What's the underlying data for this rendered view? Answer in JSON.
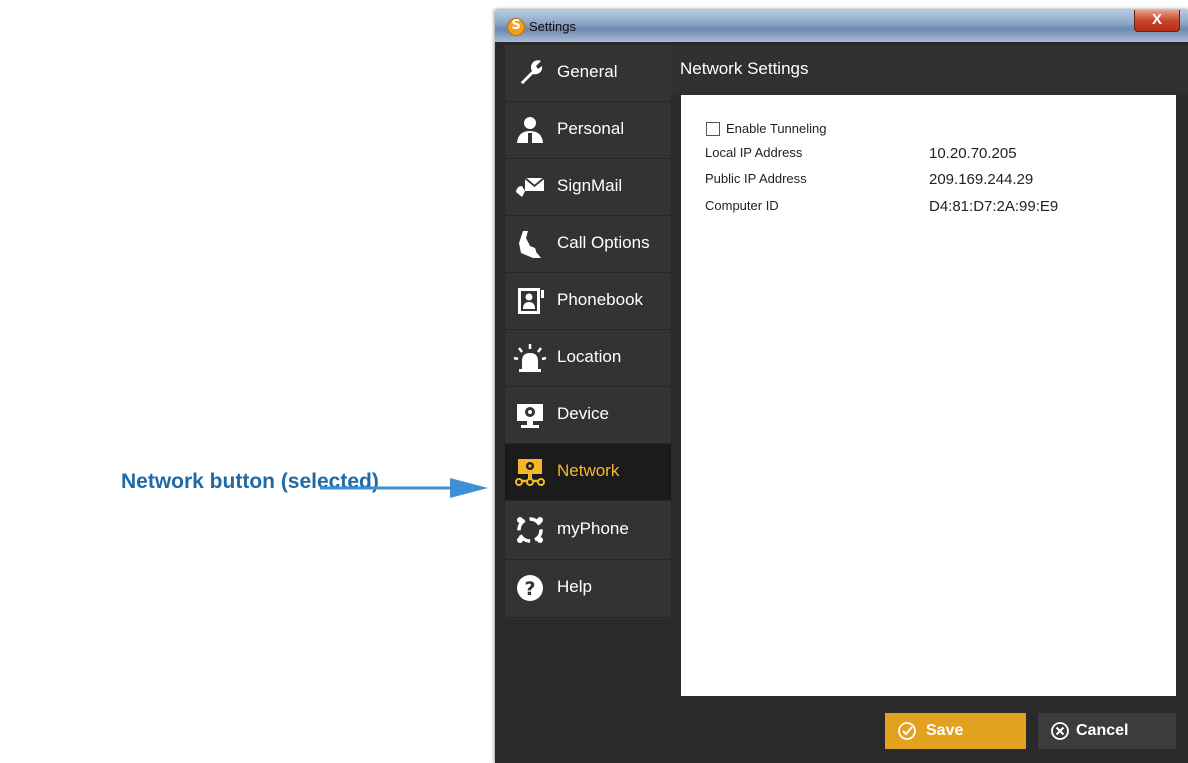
{
  "annotation": {
    "text": "Network button (selected)"
  },
  "window": {
    "title": "Settings",
    "app_icon_letter": "S",
    "close_glyph": "X"
  },
  "sidebar": {
    "items": [
      {
        "label": "General",
        "icon": "wrench-icon"
      },
      {
        "label": "Personal",
        "icon": "person-icon"
      },
      {
        "label": "SignMail",
        "icon": "signmail-icon"
      },
      {
        "label": "Call Options",
        "icon": "phone-icon"
      },
      {
        "label": "Phonebook",
        "icon": "phonebook-icon"
      },
      {
        "label": "Location",
        "icon": "siren-icon"
      },
      {
        "label": "Device",
        "icon": "camera-icon"
      },
      {
        "label": "Network",
        "icon": "network-icon",
        "selected": true
      },
      {
        "label": "myPhone",
        "icon": "myphone-icon"
      },
      {
        "label": "Help",
        "icon": "help-icon"
      }
    ]
  },
  "content": {
    "header": "Network Settings",
    "enable_tunneling": {
      "label": "Enable Tunneling",
      "checked": false
    },
    "rows": [
      {
        "label": "Local IP Address",
        "value": "10.20.70.205"
      },
      {
        "label": "Public IP Address",
        "value": "209.169.244.29"
      },
      {
        "label": "Computer ID",
        "value": "D4:81:D7:2A:99:E9"
      }
    ]
  },
  "footer": {
    "save_label": "Save",
    "cancel_label": "Cancel"
  },
  "colors": {
    "accent": "#e2a11e",
    "selected_text": "#f5b72a",
    "callout": "#1e6aa8"
  }
}
